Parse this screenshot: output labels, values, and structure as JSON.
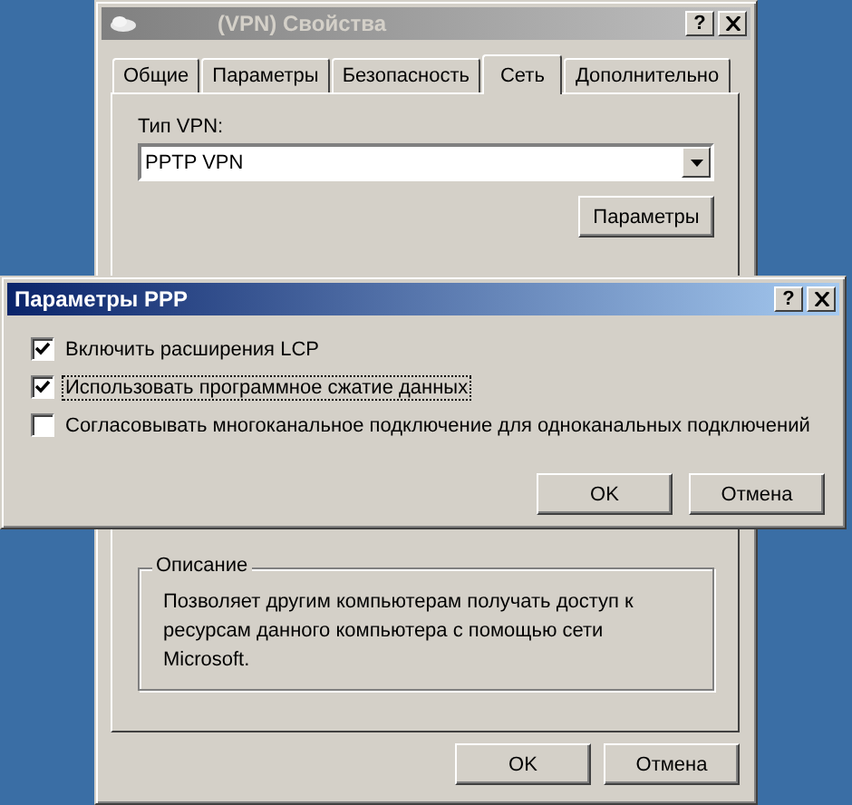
{
  "main_window": {
    "title": "(VPN) Свойства",
    "active": false,
    "help_button": "?",
    "tabs": [
      {
        "label": "Общие",
        "selected": false
      },
      {
        "label": "Параметры",
        "selected": false
      },
      {
        "label": "Безопасность",
        "selected": false
      },
      {
        "label": "Сеть",
        "selected": true
      },
      {
        "label": "Дополнительно",
        "selected": false
      }
    ],
    "vpn_type": {
      "label": "Тип VPN:",
      "value": "PPTP VPN"
    },
    "settings_button": "Параметры",
    "description": {
      "title": "Описание",
      "text": "Позволяет другим компьютерам получать доступ к ресурсам данного компьютера с помощью сети Microsoft."
    },
    "buttons": [
      "OK",
      "Отмена"
    ]
  },
  "dialog": {
    "title": "Параметры PPP",
    "active": true,
    "help_button": "?",
    "options": [
      {
        "label": "Включить расширения LCP",
        "checked": true,
        "focused": false
      },
      {
        "label": "Использовать программное сжатие данных",
        "checked": true,
        "focused": true
      },
      {
        "label": "Согласовывать многоканальное подключение для одноканальных подключений",
        "checked": false,
        "focused": false
      }
    ],
    "buttons": [
      "OK",
      "Отмена"
    ]
  }
}
